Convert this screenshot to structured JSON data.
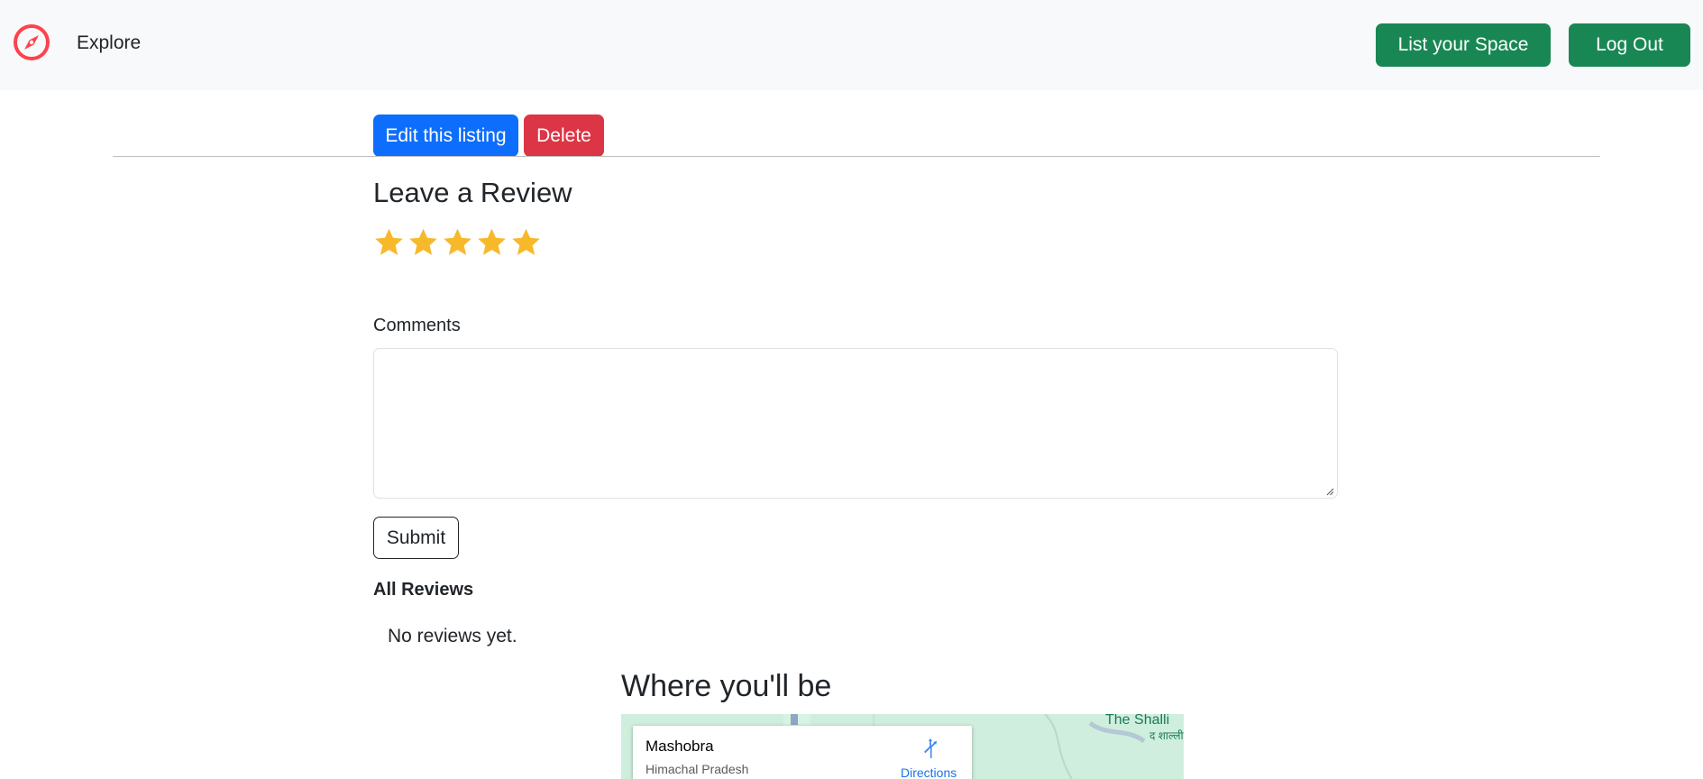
{
  "navbar": {
    "brand_icon": "compass-icon",
    "brand_color": "#fe424d",
    "explore_label": "Explore",
    "list_space_label": "List your Space",
    "logout_label": "Log Out"
  },
  "listing_actions": {
    "edit_label": "Edit this listing",
    "delete_label": "Delete"
  },
  "review_form": {
    "heading": "Leave a Review",
    "rating": 5,
    "max_rating": 5,
    "star_color": "#f7b82a",
    "comments_label": "Comments",
    "comments_value": "",
    "submit_label": "Submit"
  },
  "reviews": {
    "heading": "All Reviews",
    "empty_text": "No reviews yet."
  },
  "location": {
    "heading": "Where you'll be",
    "place_name": "Mashobra",
    "place_region": "Himachal Pradesh",
    "directions_label": "Directions",
    "map_label": "The Shalli",
    "map_label_sub": "द शाल्ली"
  }
}
